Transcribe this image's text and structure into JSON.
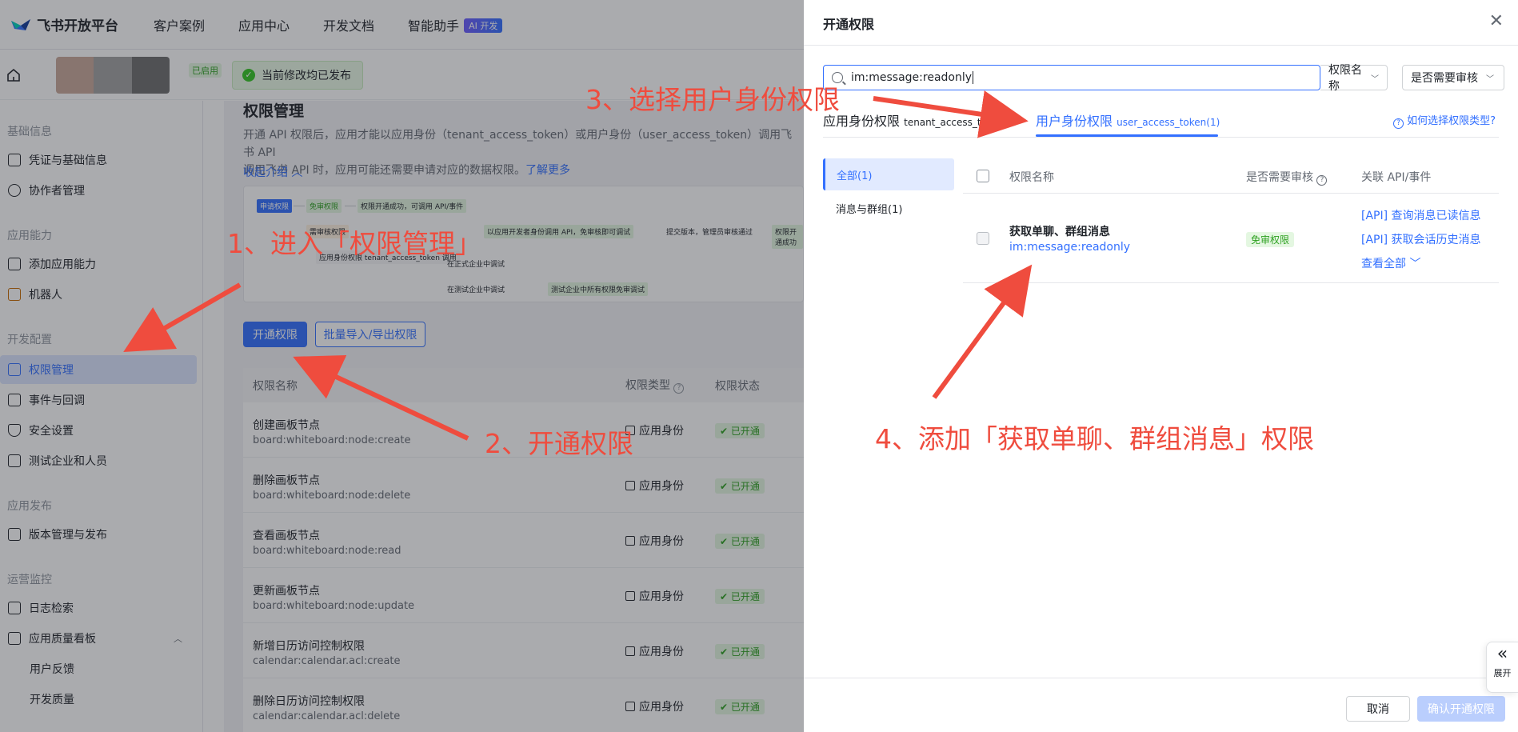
{
  "topnav": {
    "brand": "飞书开放平台",
    "items": [
      "客户案例",
      "应用中心",
      "开发文档",
      "智能助手"
    ],
    "ai_badge": "AI 开发"
  },
  "subbar": {
    "enabled_tag": "已启用",
    "publish_tip": "当前修改均已发布"
  },
  "sidebar": {
    "groups": [
      "基础信息",
      "应用能力",
      "开发配置",
      "应用发布",
      "运营监控"
    ],
    "items": [
      {
        "label": "凭证与基础信息"
      },
      {
        "label": "协作者管理"
      },
      {
        "label": "添加应用能力"
      },
      {
        "label": "机器人"
      },
      {
        "label": "权限管理"
      },
      {
        "label": "事件与回调"
      },
      {
        "label": "安全设置"
      },
      {
        "label": "测试企业和人员"
      },
      {
        "label": "版本管理与发布"
      },
      {
        "label": "日志检索"
      },
      {
        "label": "应用质量看板"
      },
      {
        "label": "用户反馈"
      },
      {
        "label": "开发质量"
      }
    ]
  },
  "main": {
    "title": "权限管理",
    "intro_line1": "开通 API 权限后，应用才能以应用身份（tenant_access_token）或用户身份（user_access_token）调用飞书 API",
    "intro_line2": "调用飞书 API 时，应用可能还需要申请对应的数据权限。",
    "intro_link": "了解更多",
    "collapse": "收起介绍",
    "flow": {
      "step_apply": "申请权限",
      "step_free": "免审权限",
      "step_ok": "权限开通成功，可调用 API/事件",
      "step_review": "需审核权限",
      "step_dev_call": "以应用开发者身份调用 API，免审核即可调试",
      "step_submit": "提交版本，管理员审核通过",
      "step_enable": "权限开通成功",
      "tenant_id": "应用身份权限",
      "tenant_token": "tenant_access_token",
      "tenant_call": "调用",
      "user_id": "应用身份权限",
      "user_token": "tenant_access_token",
      "user_call": "调用",
      "prod": "在正式企业中调试",
      "test": "在测试企业中调试",
      "test_free": "测试企业中所有权限免审调试"
    },
    "buttons": {
      "enable": "开通权限",
      "batch": "批量导入/导出权限"
    },
    "table": {
      "headers": [
        "权限名称",
        "权限类型",
        "权限状态"
      ],
      "rows": [
        {
          "name": "创建画板节点",
          "code": "board:whiteboard:node:create",
          "type": "应用身份",
          "status": "已开通"
        },
        {
          "name": "删除画板节点",
          "code": "board:whiteboard:node:delete",
          "type": "应用身份",
          "status": "已开通"
        },
        {
          "name": "查看画板节点",
          "code": "board:whiteboard:node:read",
          "type": "应用身份",
          "status": "已开通"
        },
        {
          "name": "更新画板节点",
          "code": "board:whiteboard:node:update",
          "type": "应用身份",
          "status": "已开通"
        },
        {
          "name": "新增日历访问控制权限",
          "code": "calendar:calendar.acl:create",
          "type": "应用身份",
          "status": "已开通"
        },
        {
          "name": "删除日历访问控制权限",
          "code": "calendar:calendar.acl:delete",
          "type": "应用身份",
          "status": "已开通"
        }
      ]
    }
  },
  "drawer": {
    "title": "开通权限",
    "search_value": "im:message:readonly",
    "filter_name": "权限名称",
    "filter_review": "是否需要审核",
    "tab_app": "应用身份权限",
    "tab_app_sub": "tenant_access_to...",
    "tab_user": "用户身份权限",
    "tab_user_sub": "user_access_token(1)",
    "help": "如何选择权限类型?",
    "cat_all": "全部(1)",
    "cat_msg": "消息与群组(1)",
    "col_name": "权限名称",
    "col_review": "是否需要审核",
    "col_api": "关联 API/事件",
    "row": {
      "name": "获取单聊、群组消息",
      "code": "im:message:readonly",
      "review": "免审权限",
      "api1": "[API] 查询消息已读信息",
      "api2": "[API] 获取会话历史消息",
      "more": "查看全部"
    },
    "cancel": "取消",
    "confirm": "确认开通权限",
    "expand": "展开"
  },
  "annotations": {
    "a1": "1、进入「权限管理」",
    "a2": "2、开通权限",
    "a3": "3、选择用户身份权限",
    "a4": "4、添加「获取单聊、群组消息」权限"
  },
  "colors": {
    "accent": "#3370ff",
    "annotation": "#ef4c3e",
    "success": "#2ea121"
  }
}
